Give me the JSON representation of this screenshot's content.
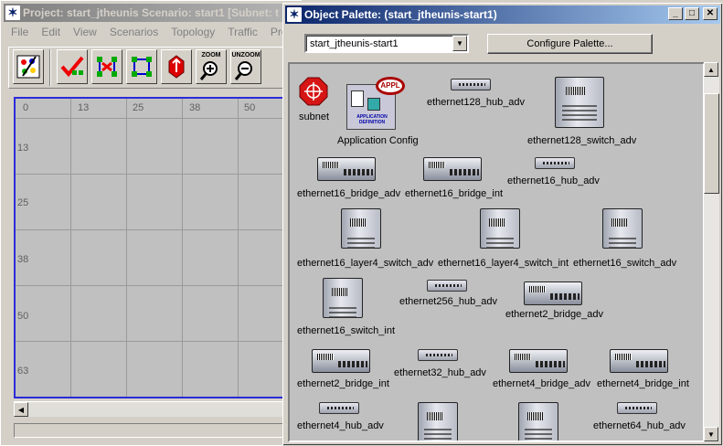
{
  "project_window": {
    "title": "Project: start_jtheunis Scenario: start1  [Subnet: t",
    "menu": [
      "File",
      "Edit",
      "View",
      "Scenarios",
      "Topology",
      "Traffic",
      "Protocols"
    ],
    "toolbar_zoom_label": "ZOOM",
    "toolbar_unzoom_label": "UNZOOM",
    "ruler_x": [
      "0",
      "13",
      "25",
      "38",
      "50"
    ],
    "ruler_y": [
      "13",
      "25",
      "38",
      "50",
      "63"
    ]
  },
  "palette_window": {
    "title": "Object Palette: (start_jtheunis-start1)",
    "window_buttons": {
      "minimize": "_",
      "maximize": "□",
      "close": "✕"
    },
    "combo_value": "start_jtheunis-start1",
    "configure_button": "Configure Palette...",
    "appl_badge": "APPL",
    "appl_caption": "APPLICATION DEFINITION",
    "objects": [
      {
        "label": "subnet",
        "icon": "subnet-icon"
      },
      {
        "label": "Application Config",
        "icon": "application-config-icon"
      },
      {
        "label": "ethernet128_hub_adv",
        "icon": "hub-icon"
      },
      {
        "label": "ethernet128_switch_adv",
        "icon": "switch-icon"
      },
      {
        "label": "ethernet16_bridge_adv",
        "icon": "bridge-icon"
      },
      {
        "label": "ethernet16_bridge_int",
        "icon": "bridge-icon"
      },
      {
        "label": "ethernet16_hub_adv",
        "icon": "hub-icon"
      },
      {
        "label": "ethernet16_layer4_switch_adv",
        "icon": "switch-icon"
      },
      {
        "label": "ethernet16_layer4_switch_int",
        "icon": "switch-icon"
      },
      {
        "label": "ethernet16_switch_adv",
        "icon": "switch-icon"
      },
      {
        "label": "ethernet16_switch_int",
        "icon": "switch-icon"
      },
      {
        "label": "ethernet256_hub_adv",
        "icon": "hub-icon"
      },
      {
        "label": "ethernet2_bridge_adv",
        "icon": "bridge-icon"
      },
      {
        "label": "ethernet2_bridge_int",
        "icon": "bridge-icon"
      },
      {
        "label": "ethernet32_hub_adv",
        "icon": "hub-icon"
      },
      {
        "label": "ethernet4_bridge_adv",
        "icon": "bridge-icon"
      },
      {
        "label": "ethernet4_bridge_int",
        "icon": "bridge-icon"
      },
      {
        "label": "ethernet4_hub_adv",
        "icon": "hub-icon"
      },
      {
        "label": "ethernet64_hub_adv",
        "icon": "hub-icon"
      }
    ]
  }
}
